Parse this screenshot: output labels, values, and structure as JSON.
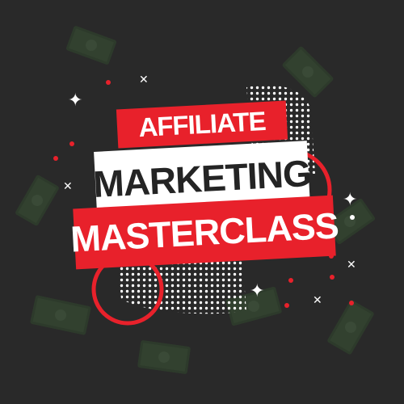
{
  "headline": {
    "line1": "AFFILIATE",
    "line2": "MARKETING",
    "line3": "MASTERCLASS"
  },
  "colors": {
    "background": "#292929",
    "accent_red": "#e8212b",
    "white": "#ffffff",
    "text_dark": "#242424",
    "bill_green": "#32412f"
  },
  "decorations": {
    "icons": [
      "money-bill-icon",
      "sparkle-icon",
      "cross-icon",
      "dot-icon",
      "halftone-dot-pattern",
      "ring-outline"
    ]
  }
}
